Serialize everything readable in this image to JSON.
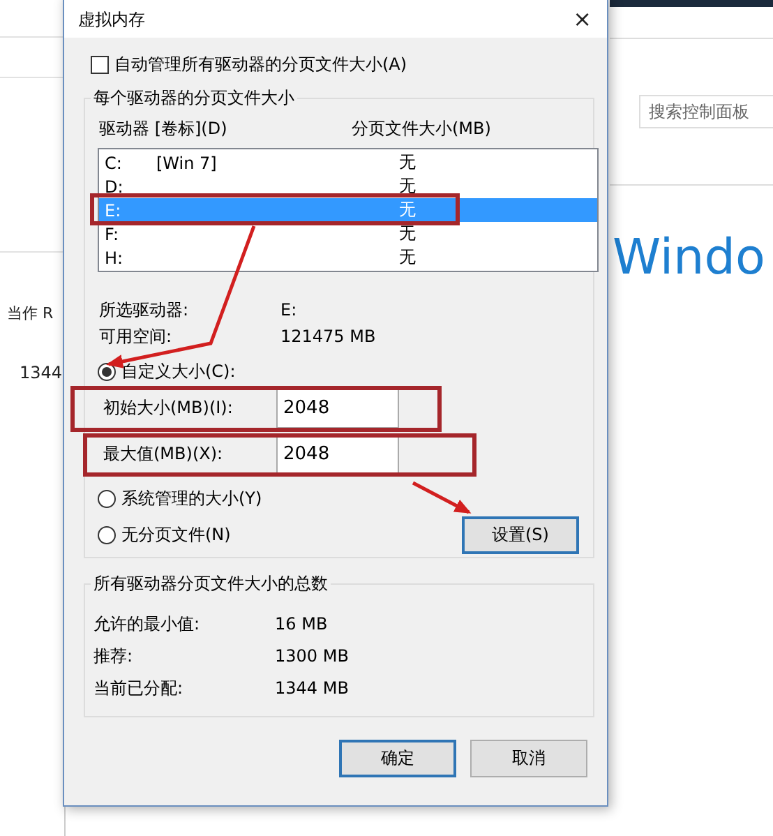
{
  "background_left": {
    "texts": [
      "当作 R",
      "1344"
    ]
  },
  "background_right": {
    "search": {
      "placeholder": "搜索控制面板"
    },
    "heading": "Windo"
  },
  "dialog": {
    "title": "虚拟内存",
    "close": "×",
    "auto_manage": {
      "label": "自动管理所有驱动器的分页文件大小(A)",
      "checked": false
    },
    "per_drive": {
      "title": "每个驱动器的分页文件大小",
      "columns": [
        "驱动器 [卷标](D)",
        "分页文件大小(MB)"
      ],
      "drives": [
        {
          "drive": "C:",
          "label": "[Win 7]",
          "size": "无",
          "selected": false
        },
        {
          "drive": "D:",
          "size": "无",
          "selected": false
        },
        {
          "drive": "E:",
          "size": "无",
          "selected": true
        },
        {
          "drive": "F:",
          "size": "无",
          "selected": false
        },
        {
          "drive": "H:",
          "size": "无",
          "selected": false
        }
      ],
      "info": [
        {
          "label": "所选驱动器:",
          "value": "E:"
        },
        {
          "label": "可用空间:",
          "value": "121475 MB"
        }
      ],
      "custom": {
        "label": "自定义大小(C):",
        "selected": true
      },
      "fields": [
        {
          "label": "初始大小(MB)(I):",
          "value": "2048"
        },
        {
          "label": "最大值(MB)(X):",
          "value": "2048"
        }
      ],
      "options": [
        {
          "label": "系统管理的大小(Y)",
          "selected": false
        },
        {
          "label": "无分页文件(N)",
          "selected": false
        }
      ],
      "set_button": "设置(S)"
    },
    "totals": {
      "title": "所有驱动器分页文件大小的总数",
      "rows": [
        {
          "label": "允许的最小值:",
          "value": "16 MB"
        },
        {
          "label": "推荐:",
          "value": "1300 MB"
        },
        {
          "label": "当前已分配:",
          "value": "1344 MB"
        }
      ]
    },
    "buttons": [
      {
        "label": "确定",
        "default": true
      },
      {
        "label": "取消",
        "default": false
      }
    ]
  }
}
